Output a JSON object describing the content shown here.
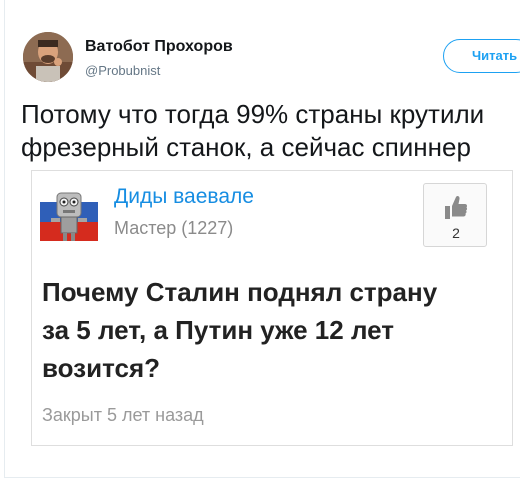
{
  "author": {
    "name": "Ватобот Прохоров",
    "handle": "@Probubnist",
    "avatar_icon": "user-avatar-photo"
  },
  "follow_button": {
    "label": "Читать",
    "color": "#1da1f2"
  },
  "tweet": {
    "lines": [
      "Потому что тогда 99% страны крутили",
      "фрезерный станок, а сейчас спиннер"
    ]
  },
  "quoted_card": {
    "user": {
      "name": "Диды ваевале",
      "rank": "Мастер (1227)",
      "avatar_icon": "robot-flag-avatar"
    },
    "like": {
      "icon": "thumbs-up-icon",
      "count": "2"
    },
    "question_lines": [
      "Почему Сталин поднял страну",
      "за 5 лет, а Путин уже 12 лет",
      "возится?"
    ],
    "status": "Закрыт 5 лет назад",
    "colors": {
      "name": "#168de2",
      "meta": "#8b8b8b"
    }
  }
}
